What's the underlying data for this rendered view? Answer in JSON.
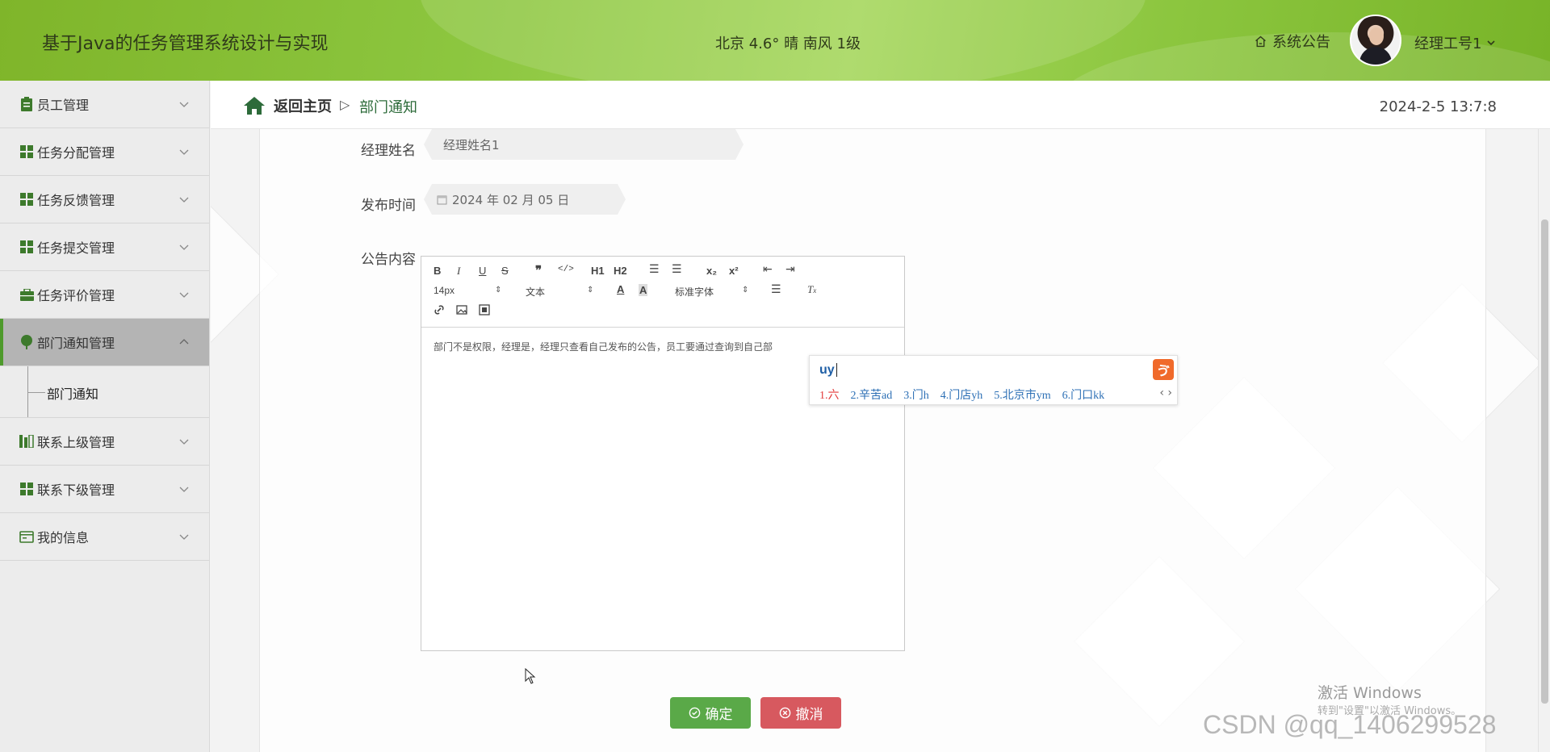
{
  "header": {
    "app_title": "基于Java的任务管理系统设计与实现",
    "weather": "北京  4.6°  晴  南风  1级",
    "notice_label": "系统公告",
    "user_label": "经理工号1"
  },
  "sidebar": {
    "items": [
      {
        "label": "员工管理",
        "icon": "clipboard-icon"
      },
      {
        "label": "任务分配管理",
        "icon": "grid-icon"
      },
      {
        "label": "任务反馈管理",
        "icon": "grid-icon"
      },
      {
        "label": "任务提交管理",
        "icon": "grid-icon"
      },
      {
        "label": "任务评价管理",
        "icon": "briefcase-icon"
      },
      {
        "label": "部门通知管理",
        "icon": "leaf-icon"
      },
      {
        "label": "联系上级管理",
        "icon": "chart-icon"
      },
      {
        "label": "联系下级管理",
        "icon": "grid-icon"
      },
      {
        "label": "我的信息",
        "icon": "id-card-icon"
      }
    ],
    "submenu_label": "部门通知"
  },
  "breadcrumb": {
    "home_label": "返回主页",
    "separator": "▷",
    "current": "部门通知"
  },
  "datetime": "2024-2-5 13:7:8",
  "form": {
    "manager_name_label": "经理姓名",
    "manager_name_value": "经理姓名1",
    "publish_time_label": "发布时间",
    "publish_time_value": "2024 年 02 月 05 日",
    "content_label": "公告内容",
    "content_text": "部门不是权限，经理是，经理只查看自己发布的公告，员工要通过查询到自己部"
  },
  "editor_toolbar": {
    "font_size": "14px",
    "block_format": "文本",
    "font_family": "标准字体",
    "h1": "H1",
    "h2": "H2"
  },
  "ime": {
    "input": "uy",
    "candidates": [
      "1.六",
      "2.辛苦ad",
      "3.门h",
      "4.门店yh",
      "5.北京市ym",
      "6.门口kk"
    ],
    "nav": "‹ ›"
  },
  "buttons": {
    "confirm": "确定",
    "cancel": "撤消"
  },
  "watermarks": {
    "windows_title": "激活 Windows",
    "windows_sub": "转到\"设置\"以激活 Windows。",
    "csdn": "CSDN @qq_1406299528"
  },
  "colors": {
    "header_green": "#8cc63f",
    "confirm_green": "#5aa948",
    "cancel_red": "#d7595f",
    "sidebar_active": "#b4b4b4"
  }
}
